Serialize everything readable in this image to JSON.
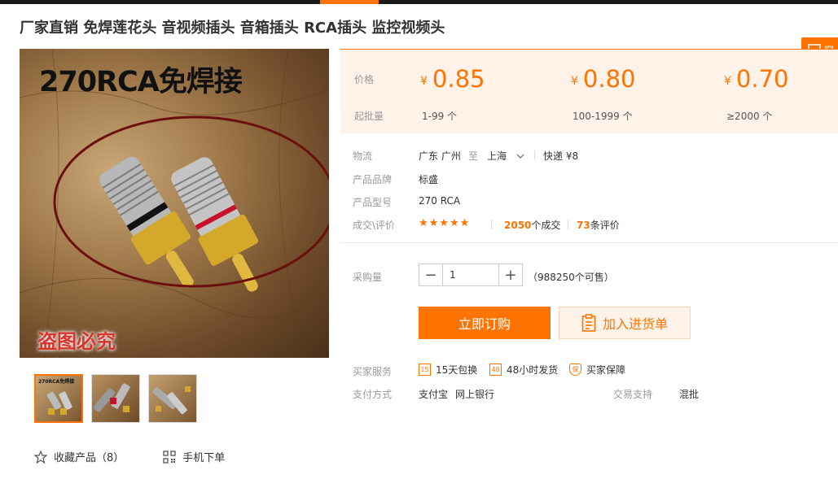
{
  "header": {
    "title": "厂家直销 免焊莲花头 音视频插头 音箱插头 RCA插头 监控视频头"
  },
  "gallery": {
    "main_caption": "270RCA免焊接",
    "watermark": "盗图必究",
    "thumb_caption": "270RCA免焊接"
  },
  "actions": {
    "favorite_label": "收藏产品（8）",
    "mobile_order_label": "手机下单"
  },
  "side_button": {
    "label": "窗"
  },
  "pricing": {
    "price_label": "价格",
    "moq_label": "起批量",
    "currency": "¥",
    "tiers": [
      {
        "price": "0.85",
        "range": "1-99 个"
      },
      {
        "price": "0.80",
        "range": "100-1999 个"
      },
      {
        "price": "0.70",
        "range": "≥2000 个"
      }
    ]
  },
  "attributes": {
    "logistics_label": "物流",
    "logistics_from": "广东 广州",
    "logistics_to_word": "至",
    "logistics_to": "上海",
    "logistics_express": "快递 ¥8",
    "brand_label": "产品品牌",
    "brand_value": "标盛",
    "model_label": "产品型号",
    "model_value": "270 RCA",
    "deals_label": "成交\\评价",
    "stars": "★★★★★",
    "deals_count": "2050",
    "deals_suffix": "个成交",
    "review_count": "73",
    "review_suffix": "条评价"
  },
  "purchase": {
    "qty_label": "采购量",
    "qty_value": "1",
    "minus": "−",
    "plus": "+",
    "available": "（988250个可售）",
    "buy_now": "立即订购",
    "add_to_list": "加入进货单"
  },
  "services": {
    "label": "买家服务",
    "items": [
      {
        "icon": "15",
        "text": "15天包换"
      },
      {
        "icon": "48",
        "text": "48小时发货"
      },
      {
        "icon": "保",
        "text": "买家保障"
      }
    ],
    "payment_label": "支付方式",
    "payment_methods": [
      "支付宝",
      "网上银行"
    ],
    "trade_support_label": "交易支持",
    "trade_support_value": "混批"
  },
  "colors": {
    "accent": "#ff7300",
    "price_bg": "#fff2e8",
    "topbar": "#1a1a1a"
  }
}
